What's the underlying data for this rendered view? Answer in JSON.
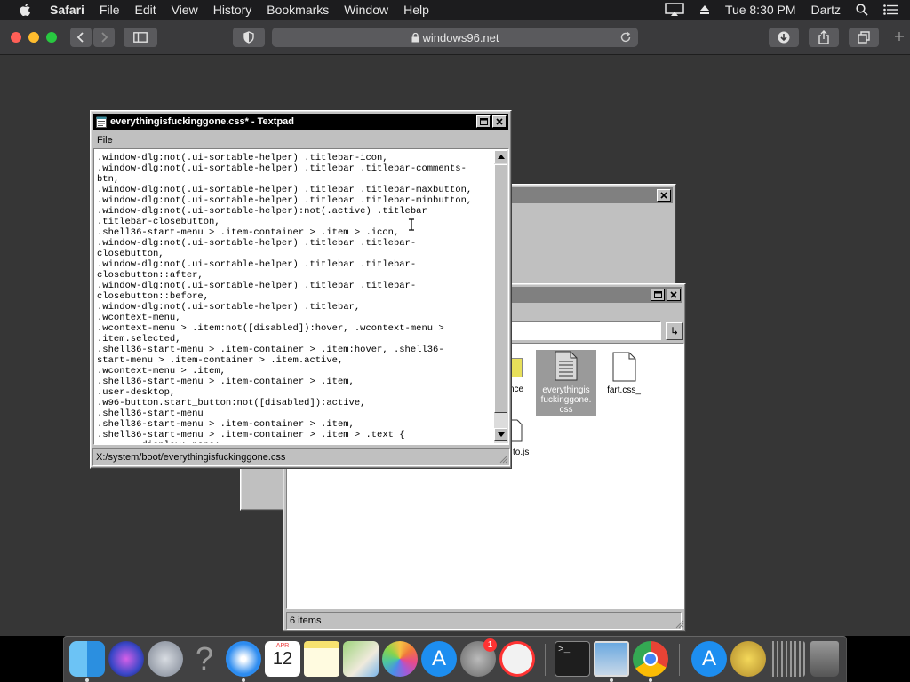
{
  "menubar": {
    "app": "Safari",
    "items": [
      "File",
      "Edit",
      "View",
      "History",
      "Bookmarks",
      "Window",
      "Help"
    ],
    "clock": "Tue 8:30 PM",
    "user": "Dartz"
  },
  "browser": {
    "url": "windows96.net"
  },
  "textpad": {
    "title": "everythingisfuckinggone.css* - Textpad",
    "menu_file": "File",
    "content": ".window-dlg:not(.ui-sortable-helper) .titlebar-icon,\n.window-dlg:not(.ui-sortable-helper) .titlebar .titlebar-comments-\nbtn,\n.window-dlg:not(.ui-sortable-helper) .titlebar .titlebar-maxbutton,\n.window-dlg:not(.ui-sortable-helper) .titlebar .titlebar-minbutton,\n.window-dlg:not(.ui-sortable-helper):not(.active) .titlebar\n.titlebar-closebutton,\n.shell36-start-menu > .item-container > .item > .icon,\n.window-dlg:not(.ui-sortable-helper) .titlebar .titlebar-\nclosebutton,\n.window-dlg:not(.ui-sortable-helper) .titlebar .titlebar-\nclosebutton::after,\n.window-dlg:not(.ui-sortable-helper) .titlebar .titlebar-\nclosebutton::before,\n.window-dlg:not(.ui-sortable-helper) .titlebar,\n.wcontext-menu,\n.wcontext-menu > .item:not([disabled]):hover, .wcontext-menu >\n.item.selected,\n.shell36-start-menu > .item-container > .item:hover, .shell36-\nstart-menu > .item-container > .item.active,\n.wcontext-menu > .item,\n.shell36-start-menu > .item-container > .item,\n.user-desktop,\n.w96-button.start_button:not([disabled]):active,\n.shell36-start-menu\n.shell36-start-menu > .item-container > .item,\n.shell36-start-menu > .item-container > .item > .text {\n        display: none;",
    "status_path": "X:/system/boot/everythingisfuckinggone.css"
  },
  "explorer": {
    "files": [
      {
        "label_lines": [
          "nce"
        ],
        "icon": "folder-icon"
      },
      {
        "label_lines": [
          "everythingis",
          "fuckinggone.",
          "css"
        ],
        "icon": "document-icon",
        "selected": true
      },
      {
        "label_lines": [
          "fart.css_"
        ],
        "icon": "blank-file-icon"
      },
      {
        "label_lines": [
          "to.js"
        ],
        "icon": "js-file-icon"
      }
    ],
    "status": "6 items",
    "go_button": "↳"
  },
  "dock": {
    "calendar_month": "APR",
    "calendar_day": "12",
    "settings_badge": "1",
    "items": [
      "finder-icon",
      "siri-icon",
      "launchpad-icon",
      "help-icon",
      "safari-icon",
      "calendar-icon",
      "notes-icon",
      "maps-icon",
      "photos-icon",
      "app-store-icon",
      "system-preferences-icon",
      "news-icon",
      "terminal-icon",
      "preview-icon",
      "chrome-icon",
      "app-store-icon-2",
      "character-icon",
      "grid-app-icon",
      "trash-icon"
    ]
  },
  "colors": {
    "win_face": "#c0c0c0",
    "titlebar_active": "#000000",
    "titlebar_inactive": "#808080",
    "page_bg": "#363636"
  }
}
